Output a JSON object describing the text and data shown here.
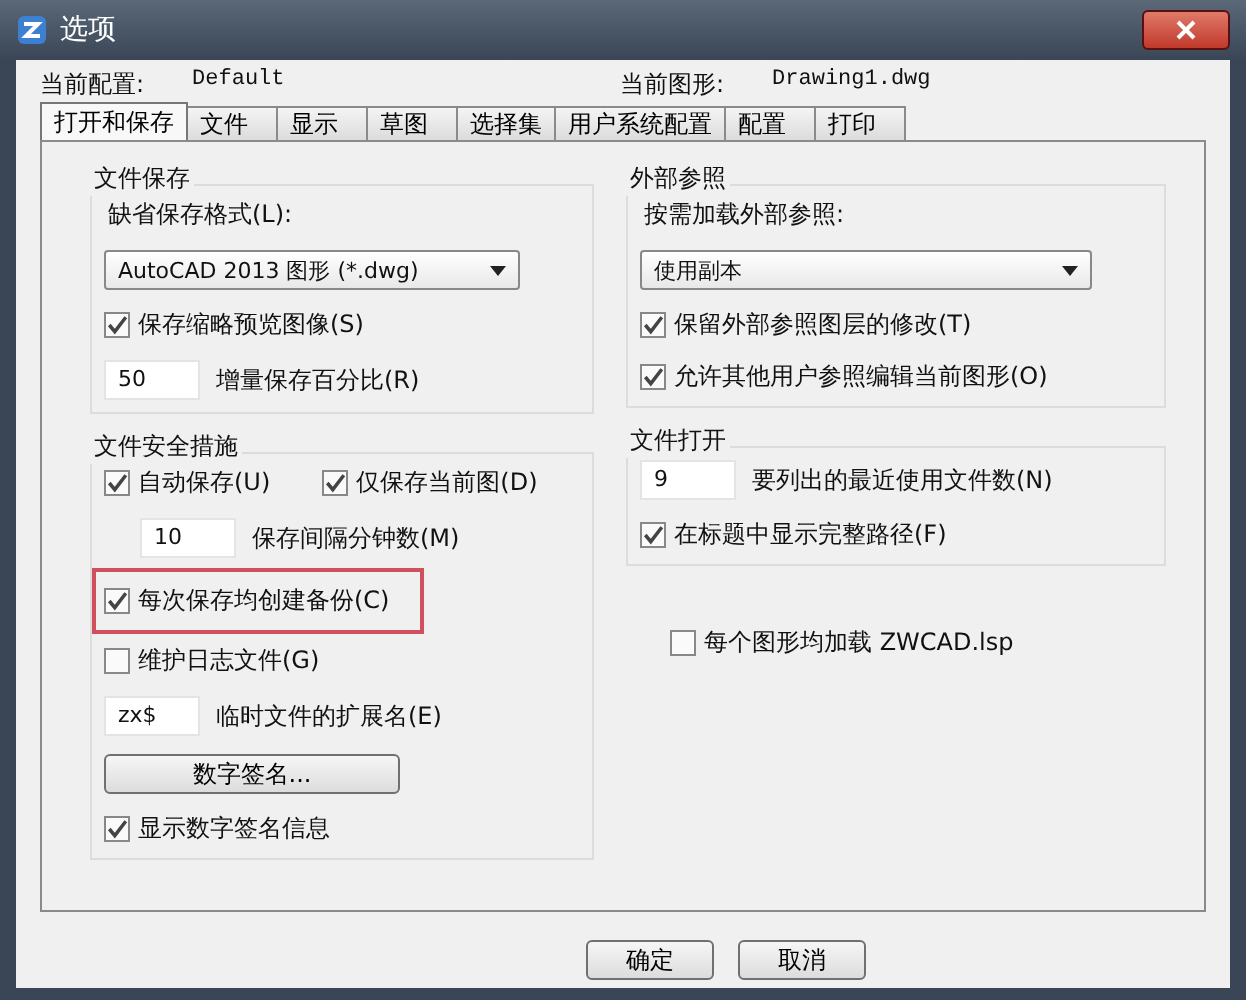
{
  "window": {
    "title": "选项"
  },
  "header": [
    {
      "label": "当前配置:",
      "value": "Default"
    },
    {
      "label": "当前图形:",
      "value": "Drawing1.dwg"
    }
  ],
  "tabs": [
    {
      "label": "打开和保存",
      "selected": true
    },
    {
      "label": "文件",
      "selected": false
    },
    {
      "label": "显示",
      "selected": false
    },
    {
      "label": "草图",
      "selected": false
    },
    {
      "label": "选择集",
      "selected": false
    },
    {
      "label": "用户系统配置",
      "selected": false
    },
    {
      "label": "配置",
      "selected": false
    },
    {
      "label": "打印",
      "selected": false
    }
  ],
  "columns": [
    [
      {
        "title": "文件保存",
        "items": [
          {
            "kind": "label",
            "text": "缺省保存格式(L):"
          },
          {
            "kind": "dropdown",
            "value": "AutoCAD 2013 图形 (*.dwg)"
          },
          {
            "kind": "checkbox",
            "label": "保存缩略预览图像(S)",
            "checked": true,
            "highlighted": false
          },
          {
            "kind": "number",
            "value": "50",
            "caption": "增量保存百分比(R)"
          }
        ]
      },
      {
        "title": "文件安全措施",
        "items": [
          {
            "kind": "checkbox_row",
            "checkboxes": [
              {
                "label": "自动保存(U)",
                "checked": true
              },
              {
                "label": "仅保存当前图(D)",
                "checked": true
              }
            ]
          },
          {
            "kind": "number_indented",
            "value": "10",
            "caption": "保存间隔分钟数(M)"
          },
          {
            "kind": "checkbox",
            "label": "每次保存均创建备份(C)",
            "checked": true,
            "highlighted": true
          },
          {
            "kind": "checkbox",
            "label": "维护日志文件(G)",
            "checked": false,
            "highlighted": false
          },
          {
            "kind": "number",
            "value": "zx$",
            "caption": "临时文件的扩展名(E)"
          },
          {
            "kind": "button",
            "label": "数字签名..."
          },
          {
            "kind": "checkbox",
            "label": "显示数字签名信息",
            "checked": true,
            "highlighted": false
          }
        ]
      }
    ],
    [
      {
        "title": "外部参照",
        "items": [
          {
            "kind": "label",
            "text": "按需加载外部参照:"
          },
          {
            "kind": "dropdown",
            "value": "使用副本"
          },
          {
            "kind": "checkbox",
            "label": "保留外部参照图层的修改(T)",
            "checked": true,
            "highlighted": false
          },
          {
            "kind": "checkbox",
            "label": "允许其他用户参照编辑当前图形(O)",
            "checked": true,
            "highlighted": false
          }
        ]
      },
      {
        "title": "文件打开",
        "items": [
          {
            "kind": "number",
            "value": "9",
            "caption": "要列出的最近使用文件数(N)"
          },
          {
            "kind": "checkbox",
            "label": "在标题中显示完整路径(F)",
            "checked": true,
            "highlighted": false
          }
        ]
      },
      {
        "items": [
          {
            "kind": "checkbox",
            "label": "每个图形均加载 ZWCAD.lsp",
            "checked": false,
            "highlighted": false
          }
        ]
      }
    ]
  ],
  "buttons": [
    "确定",
    "取消"
  ]
}
